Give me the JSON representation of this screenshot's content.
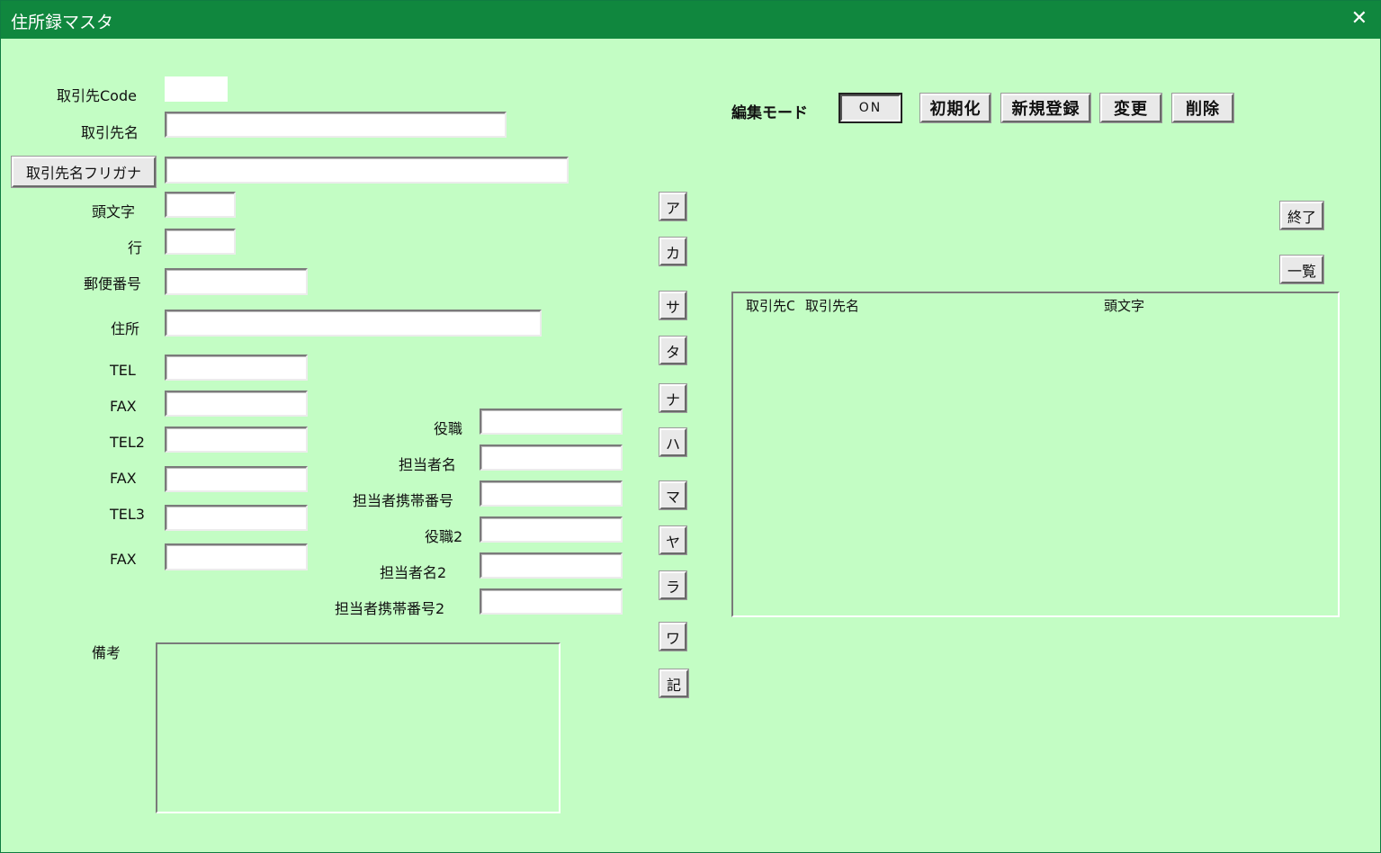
{
  "window": {
    "title": "住所録マスタ",
    "close": "✕"
  },
  "labels": {
    "code": "取引先Code",
    "name": "取引先名",
    "initial": "頭文字",
    "row": "行",
    "zip": "郵便番号",
    "address": "住所",
    "tel": "TEL",
    "fax": "FAX",
    "tel2": "TEL2",
    "fax2": "FAX",
    "tel3": "TEL3",
    "fax3": "FAX",
    "position": "役職",
    "contact": "担当者名",
    "mobile": "担当者携帯番号",
    "position2": "役職2",
    "contact2": "担当者名2",
    "mobile2": "担当者携帯番号2",
    "remarks": "備考"
  },
  "buttons": {
    "furigana": "取引先名フリガナ",
    "edit_mode_label": "編集モード",
    "on": "ON",
    "init": "初期化",
    "new": "新規登録",
    "change": "変更",
    "delete": "削除",
    "exit": "終了",
    "list": "一覧"
  },
  "kana": [
    "ア",
    "カ",
    "サ",
    "タ",
    "ナ",
    "ハ",
    "マ",
    "ヤ",
    "ラ",
    "ワ",
    "記"
  ],
  "list": {
    "columns": [
      "取引先Code",
      "取引先名",
      "頭文字"
    ]
  },
  "colors": {
    "background": "#c3fdc4",
    "titlebar": "#10873e"
  }
}
